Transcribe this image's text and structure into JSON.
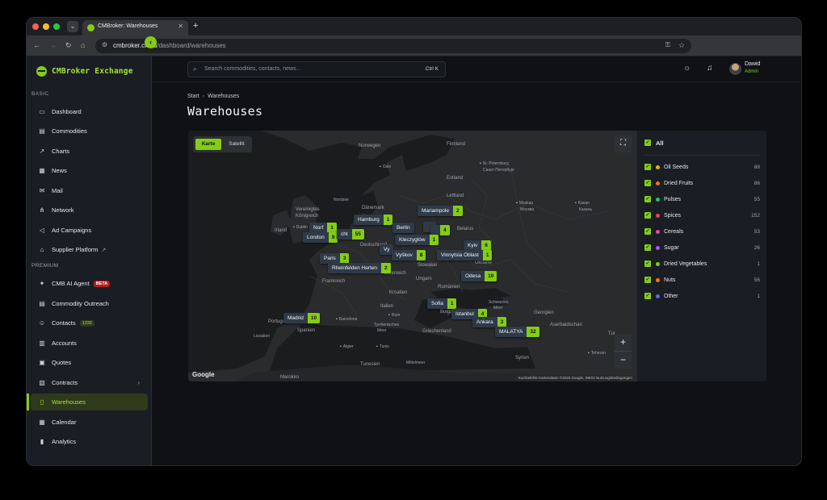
{
  "browser": {
    "tab_title": "CMBroker: Warehouses",
    "url_host": "cmbroker.cloud",
    "url_path": "/dashboard/warehouses"
  },
  "sidebar": {
    "brand": "CMBroker Exchange",
    "sections": {
      "basic": "BASIC",
      "premium": "PREMIUM"
    },
    "items": [
      {
        "label": "Dashboard",
        "icon": "monitor-icon"
      },
      {
        "label": "Commodities",
        "icon": "box-icon"
      },
      {
        "label": "Charts",
        "icon": "chart-icon"
      },
      {
        "label": "News",
        "icon": "news-icon"
      },
      {
        "label": "Mail",
        "icon": "mail-icon"
      },
      {
        "label": "Network",
        "icon": "network-icon"
      },
      {
        "label": "Ad Campaigns",
        "icon": "megaphone-icon"
      },
      {
        "label": "Supplier Platform",
        "icon": "store-icon"
      },
      {
        "label": "CMB AI Agent",
        "icon": "sparkle-icon",
        "badge": "BETA"
      },
      {
        "label": "Commodity Outreach",
        "icon": "outreach-icon"
      },
      {
        "label": "Contacts",
        "icon": "contacts-icon",
        "count": "1332"
      },
      {
        "label": "Accounts",
        "icon": "building-icon"
      },
      {
        "label": "Quotes",
        "icon": "quote-icon"
      },
      {
        "label": "Contracts",
        "icon": "contract-icon"
      },
      {
        "label": "Warehouses",
        "icon": "map-icon"
      },
      {
        "label": "Calendar",
        "icon": "calendar-icon"
      },
      {
        "label": "Analytics",
        "icon": "analytics-icon"
      }
    ]
  },
  "topbar": {
    "search_placeholder": "Search commodities, contacts, news...",
    "search_shortcut": "Ctrl K",
    "user_name": "Dawid",
    "user_role": "Admin"
  },
  "breadcrumb": {
    "home": "Start",
    "current": "Warehouses"
  },
  "page_title": "Warehouses",
  "map": {
    "tabs": [
      "Karte",
      "Satellit"
    ],
    "google": "Google",
    "attribution": "Kurzbefehle  Kartendaten ©2026 Google, INEGI  Nutzungsbedingungen",
    "places": [
      "Norwegen",
      "Finnland",
      "Oslo",
      "St. Petersburg",
      "Санкт-Петербург",
      "Estland",
      "Lettland",
      "Nordsee",
      "Dänemark",
      "Vereinigtes",
      "Königreich",
      "Irland",
      "Dublin",
      "Moskau",
      "Москва",
      "Kasan",
      "Казань",
      "Belarus",
      "Deutschland",
      "Slowakei",
      "Ukraine",
      "Frankreich",
      "Österreich",
      "Ungarn",
      "Kroatien",
      "Rumänien",
      "Italien",
      "Bulgarien",
      "Portugal",
      "Spanien",
      "Lissabon",
      "Barcelona",
      "Rom",
      "Tyrrhenisches",
      "Meer",
      "Griechenland",
      "Georgien",
      "Aserbaidschan",
      "Syrien",
      "Teheran",
      "Algier",
      "Tunis",
      "Tunesien",
      "Marokko",
      "Mittelmeer",
      "Schwarzes",
      "Meer",
      "Tur"
    ],
    "markers": [
      {
        "name": "Hamburg",
        "count": "1"
      },
      {
        "name": "Berlin",
        "count": ""
      },
      {
        "name": "Norf",
        "count": "1"
      },
      {
        "name": "London",
        "count": "9"
      },
      {
        "name": "cht",
        "count": "55"
      },
      {
        "name": "Mariampole",
        "count": "2"
      },
      {
        "name": "Kleczyglów",
        "count": "1"
      },
      {
        "name": "",
        "count": "4"
      },
      {
        "name": "Kyiv",
        "count": "6"
      },
      {
        "name": "Vy",
        "count": ""
      },
      {
        "name": "Vyškov",
        "count": "8"
      },
      {
        "name": "Vinnytsia Oblast",
        "count": "1"
      },
      {
        "name": "Paris",
        "count": "3"
      },
      {
        "name": "Rheinfelden Herten",
        "count": "2"
      },
      {
        "name": "Odesa",
        "count": "10"
      },
      {
        "name": "Sofia",
        "count": "1"
      },
      {
        "name": "Istanbul",
        "count": "4"
      },
      {
        "name": "Ankara",
        "count": "3"
      },
      {
        "name": "MALATYA",
        "count": "32"
      },
      {
        "name": "Madrid",
        "count": "10"
      }
    ]
  },
  "filters": {
    "all": "All",
    "items": [
      {
        "label": "Oil Seeds",
        "count": "88",
        "color": "#eab308"
      },
      {
        "label": "Dried Fruits",
        "count": "86",
        "color": "#f97316"
      },
      {
        "label": "Pulses",
        "count": "55",
        "color": "#22c55e"
      },
      {
        "label": "Spices",
        "count": "152",
        "color": "#ef4444"
      },
      {
        "label": "Cereals",
        "count": "53",
        "color": "#ec4899"
      },
      {
        "label": "Sugar",
        "count": "26",
        "color": "#a855f7"
      },
      {
        "label": "Dried Vegetables",
        "count": "1",
        "color": "#84cc16"
      },
      {
        "label": "Nuts",
        "count": "56",
        "color": "#f97316"
      },
      {
        "label": "Other",
        "count": "1",
        "color": "#6366f1"
      }
    ]
  }
}
